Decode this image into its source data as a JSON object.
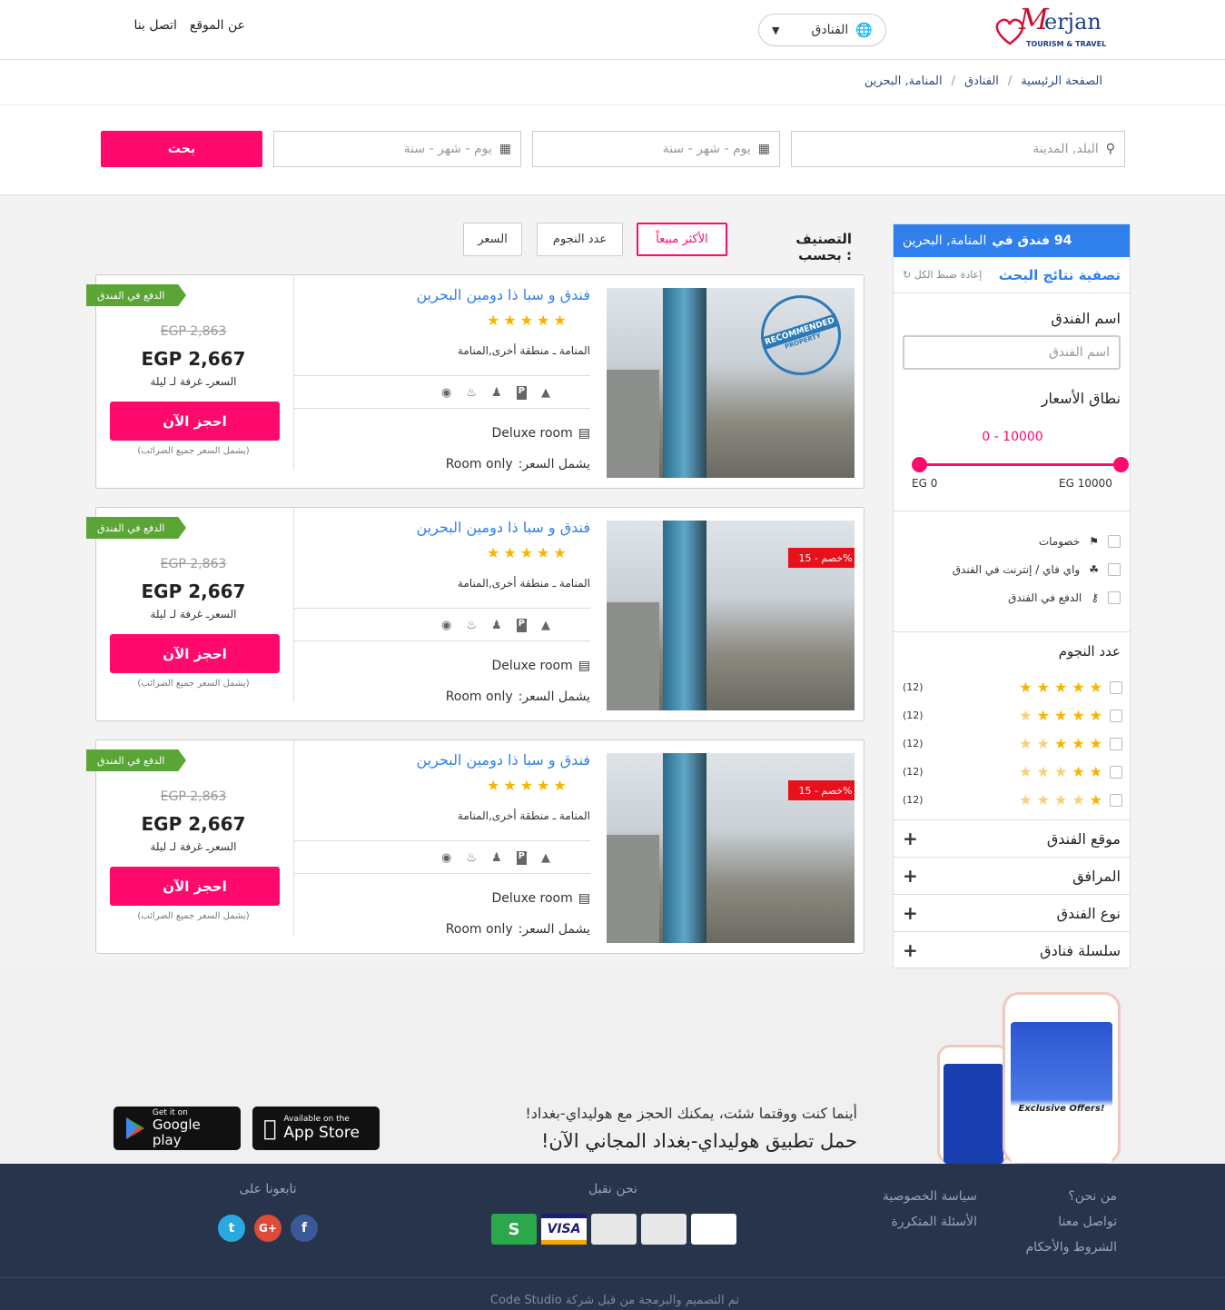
{
  "header": {
    "logo_initial": "M",
    "logo_name": "erjan",
    "logo_tagline": "TOURISM & TRAVEL",
    "category_select": "الفنادق",
    "nav": [
      "عن الموقع",
      "اتصل بنا"
    ]
  },
  "breadcrumb": [
    "الصفحة الرئيسية",
    "الفنادق",
    "المنامة, البحرين"
  ],
  "search": {
    "city_placeholder": "البلد, المدينة",
    "checkin_placeholder": "يوم - شهر - سنة",
    "checkout_placeholder": "يوم - شهر - سنة",
    "button": "بحث"
  },
  "sidebar": {
    "count_text": "94 فندق في",
    "location": "المنامة, البحرين",
    "filter_title": "تصفية نتائج البحث",
    "reset": "إعادة ضبط الكل",
    "hotel_name_label": "اسم الفندق",
    "hotel_name_placeholder": "اسم الفندق",
    "price_range_label": "نطاق الأسعار",
    "price_range_value": "0 - 10000",
    "price_min": "EG 0",
    "price_max": "EG 10000",
    "options": [
      "خصومات",
      "واي فاي / إنترنت في الفندق",
      "الدفع في الفندق"
    ],
    "stars_label": "عدد النجوم",
    "star_rows": [
      {
        "count": "(12)",
        "filled": 5
      },
      {
        "count": "(12)",
        "filled": 4
      },
      {
        "count": "(12)",
        "filled": 3
      },
      {
        "count": "(12)",
        "filled": 2
      },
      {
        "count": "(12)",
        "filled": 1
      }
    ],
    "accordions": [
      "موقع الفندق",
      "المرافق",
      "نوع الفندق",
      "سلسلة فنادق"
    ]
  },
  "sort": {
    "label": "التصنيف بحسب :",
    "options": [
      "الأكثر مبيعاً",
      "عدد النجوم",
      "السعر"
    ],
    "active": "الأكثر مبيعاً"
  },
  "hotels": [
    {
      "name": "فندق و سبا ذا دومين البحرين",
      "stars": 5,
      "location": "المنامة ـ منطقة أخرى,المنامة",
      "room": "Deluxe room",
      "includes_label": "يشمل السعر:",
      "includes": "Room only",
      "ribbon": "الدفع في الفندق",
      "old_price": "EGP 2,863",
      "price": "EGP 2,667",
      "price_note": "السعرـ غرفة لـ ليلة",
      "book": "احجز الآن",
      "tax_note": "(يشمل السعر جميع الضرائب)",
      "badge": "RECOMMENDED",
      "badge_sub": "PROPERTY",
      "discount": ""
    },
    {
      "name": "فندق و سبا ذا دومين البحرين",
      "stars": 5,
      "location": "المنامة ـ منطقة أخرى,المنامة",
      "room": "Deluxe room",
      "includes_label": "يشمل السعر:",
      "includes": "Room only",
      "ribbon": "الدفع في الفندق",
      "old_price": "EGP 2,863",
      "price": "EGP 2,667",
      "price_note": "السعرـ غرفة لـ ليلة",
      "book": "احجز الآن",
      "tax_note": "(يشمل السعر جميع الضرائب)",
      "badge": "",
      "badge_sub": "",
      "discount": "خصم - 15%"
    },
    {
      "name": "فندق و سبا ذا دومين البحرين",
      "stars": 5,
      "location": "المنامة ـ منطقة أخرى,المنامة",
      "room": "Deluxe room",
      "includes_label": "يشمل السعر:",
      "includes": "Room only",
      "ribbon": "الدفع في الفندق",
      "old_price": "EGP 2,863",
      "price": "EGP 2,667",
      "price_note": "السعرـ غرفة لـ ليلة",
      "book": "احجز الآن",
      "tax_note": "(يشمل السعر جميع الضرائب)",
      "badge": "",
      "badge_sub": "",
      "discount": "خصم - 15%"
    }
  ],
  "app": {
    "line1": "أينما كنت ووقتما شئت، يمكنك الحجز مع هوليداي-بغداد!",
    "line2": "حمل تطبيق هوليداي-بغداد المجاني الآن!",
    "appstore_small": "Available on the",
    "appstore_big": "App Store",
    "gplay_small": "Get it on",
    "gplay_big": "Google play",
    "phone_offer": "Exclusive Offers!"
  },
  "footer": {
    "col1": [
      "من نحن؟",
      "تواصل معنا",
      "الشروط والأحكام"
    ],
    "col2": [
      "سياسة الخصوصية",
      "الأسئلة المتكررة"
    ],
    "payments_title": "نحن نقبل",
    "payments": [
      "VISA"
    ],
    "follow_title": "تابعونا على",
    "social": [
      "f",
      "G+",
      "t"
    ],
    "credit": "تم التصميم والبرمجة من قبل شركة Code Studio"
  },
  "colors": {
    "accent": "#ff0a6c",
    "blue": "#2f80ed",
    "green": "#5aa535",
    "footer": "#27344c"
  }
}
